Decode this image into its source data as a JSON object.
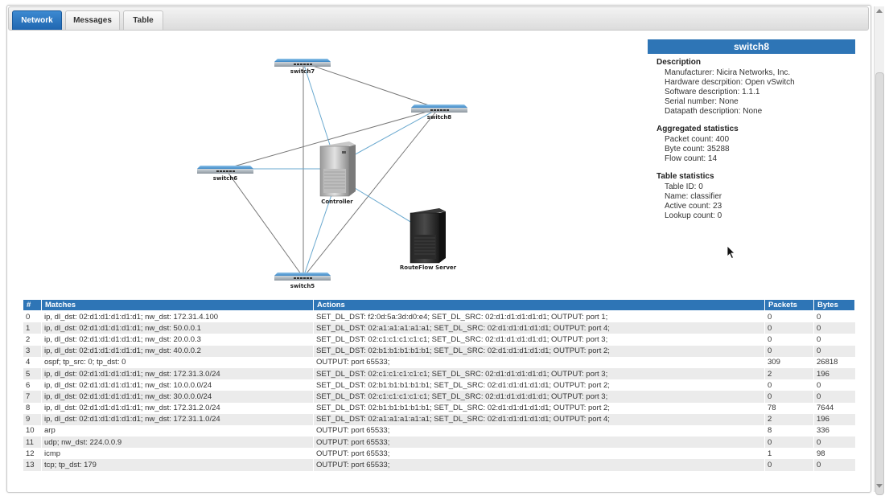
{
  "tabs": [
    {
      "label": "Network",
      "active": true
    },
    {
      "label": "Messages",
      "active": false
    },
    {
      "label": "Table",
      "active": false
    }
  ],
  "topology": {
    "switches": [
      "switch7",
      "switch8",
      "switch6",
      "switch5"
    ],
    "servers": [
      "Controller",
      "RouteFlow Server"
    ]
  },
  "detail": {
    "title": "switch8",
    "description": {
      "heading": "Description",
      "lines": [
        "Manufacturer: Nicira Networks, Inc.",
        "Hardware descrpition: Open vSwitch",
        "Software description: 1.1.1",
        "Serial number: None",
        "Datapath description: None"
      ]
    },
    "aggregated": {
      "heading": "Aggregated statistics",
      "lines": [
        "Packet count: 400",
        "Byte count: 35288",
        "Flow count: 14"
      ]
    },
    "table_stats": {
      "heading": "Table statistics",
      "lines": [
        "Table ID: 0",
        "Name: classifier",
        "Active count: 23",
        "Lookup count: 0"
      ]
    }
  },
  "flow_table": {
    "columns": [
      "#",
      "Matches",
      "Actions",
      "Packets",
      "Bytes"
    ],
    "rows": [
      [
        "0",
        "ip, dl_dst: 02:d1:d1:d1:d1:d1; nw_dst: 172.31.4.100",
        "SET_DL_DST: f2:0d:5a:3d:d0:e4; SET_DL_SRC: 02:d1:d1:d1:d1:d1; OUTPUT: port 1;",
        "0",
        "0"
      ],
      [
        "1",
        "ip, dl_dst: 02:d1:d1:d1:d1:d1; nw_dst: 50.0.0.1",
        "SET_DL_DST: 02:a1:a1:a1:a1:a1; SET_DL_SRC: 02:d1:d1:d1:d1:d1; OUTPUT: port 4;",
        "0",
        "0"
      ],
      [
        "2",
        "ip, dl_dst: 02:d1:d1:d1:d1:d1; nw_dst: 20.0.0.3",
        "SET_DL_DST: 02:c1:c1:c1:c1:c1; SET_DL_SRC: 02:d1:d1:d1:d1:d1; OUTPUT: port 3;",
        "0",
        "0"
      ],
      [
        "3",
        "ip, dl_dst: 02:d1:d1:d1:d1:d1; nw_dst: 40.0.0.2",
        "SET_DL_DST: 02:b1:b1:b1:b1:b1; SET_DL_SRC: 02:d1:d1:d1:d1:d1; OUTPUT: port 2;",
        "0",
        "0"
      ],
      [
        "4",
        "ospf; tp_src: 0; tp_dst: 0",
        "OUTPUT: port 65533;",
        "309",
        "26818"
      ],
      [
        "5",
        "ip, dl_dst: 02:d1:d1:d1:d1:d1; nw_dst: 172.31.3.0/24",
        "SET_DL_DST: 02:c1:c1:c1:c1:c1; SET_DL_SRC: 02:d1:d1:d1:d1:d1; OUTPUT: port 3;",
        "2",
        "196"
      ],
      [
        "6",
        "ip, dl_dst: 02:d1:d1:d1:d1:d1; nw_dst: 10.0.0.0/24",
        "SET_DL_DST: 02:b1:b1:b1:b1:b1; SET_DL_SRC: 02:d1:d1:d1:d1:d1; OUTPUT: port 2;",
        "0",
        "0"
      ],
      [
        "7",
        "ip, dl_dst: 02:d1:d1:d1:d1:d1; nw_dst: 30.0.0.0/24",
        "SET_DL_DST: 02:c1:c1:c1:c1:c1; SET_DL_SRC: 02:d1:d1:d1:d1:d1; OUTPUT: port 3;",
        "0",
        "0"
      ],
      [
        "8",
        "ip, dl_dst: 02:d1:d1:d1:d1:d1; nw_dst: 172.31.2.0/24",
        "SET_DL_DST: 02:b1:b1:b1:b1:b1; SET_DL_SRC: 02:d1:d1:d1:d1:d1; OUTPUT: port 2;",
        "78",
        "7644"
      ],
      [
        "9",
        "ip, dl_dst: 02:d1:d1:d1:d1:d1; nw_dst: 172.31.1.0/24",
        "SET_DL_DST: 02:a1:a1:a1:a1:a1; SET_DL_SRC: 02:d1:d1:d1:d1:d1; OUTPUT: port 4;",
        "2",
        "196"
      ],
      [
        "10",
        "arp",
        "OUTPUT: port 65533;",
        "8",
        "336"
      ],
      [
        "11",
        "udp; nw_dst: 224.0.0.9",
        "OUTPUT: port 65533;",
        "0",
        "0"
      ],
      [
        "12",
        "icmp",
        "OUTPUT: port 65533;",
        "1",
        "98"
      ],
      [
        "13",
        "tcp; tp_dst: 179",
        "OUTPUT: port 65533;",
        "0",
        "0"
      ]
    ]
  },
  "colors": {
    "accent": "#2e75b6",
    "link_gray": "#777777",
    "link_blue": "#6aa9cf"
  }
}
